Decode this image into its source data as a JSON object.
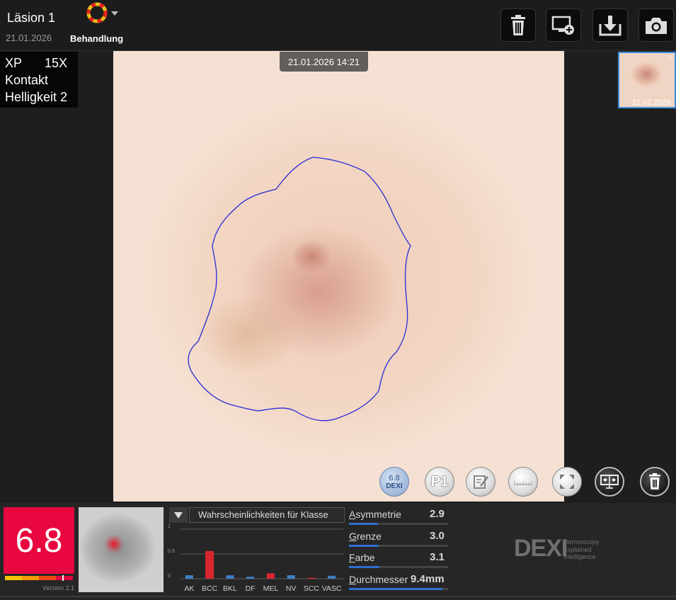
{
  "header": {
    "lesion_title": "Läsion 1",
    "lesion_date": "21.01.2026",
    "treatment_label": "Behandlung",
    "treatment_icon": "treatment-ring-icon",
    "buttons": [
      "trash-icon",
      "add-monitor-icon",
      "download-icon",
      "camera-icon"
    ]
  },
  "image_info": {
    "mode": "XP",
    "zoom": "15X",
    "contact": "Kontakt",
    "brightness": "Helligkeit 2"
  },
  "image": {
    "timestamp": "21.01.2026 14:21"
  },
  "thumbnail": {
    "date": "21.01.2026",
    "close": "×"
  },
  "image_controls": {
    "dexi_score": "6.8",
    "dexi_label": "DEXI",
    "p1_label": "P1",
    "icons": [
      "dexi-score-icon",
      "p1-icon",
      "edit-note-icon",
      "ruler-icon",
      "fullscreen-icon",
      "compare-icon",
      "delete-icon"
    ]
  },
  "score": {
    "value": "6.8",
    "version": "Version 2.1",
    "level": 0.68,
    "color": "#e8073e"
  },
  "probability": {
    "dropdown_label": "Wahrscheinlichkeiten für Klasse"
  },
  "chart_data": {
    "type": "bar",
    "categories": [
      "AK",
      "BCC",
      "BKL",
      "DF",
      "MEL",
      "NV",
      "SCC",
      "VASC"
    ],
    "values": [
      0.07,
      0.56,
      0.07,
      0.04,
      0.11,
      0.07,
      0.02,
      0.06
    ],
    "highlight": [
      "BCC",
      "MEL",
      "SCC"
    ],
    "ylim": [
      0,
      1
    ],
    "yticks": [
      "0",
      "0.5",
      "1"
    ],
    "colors": {
      "default": "#3f7fc6",
      "highlight": "#d8272f"
    }
  },
  "metrics": [
    {
      "first": "A",
      "rest": "symmetrie",
      "value": "2.9",
      "fill": 0.29
    },
    {
      "first": "G",
      "rest": "renze",
      "value": "3.0",
      "fill": 0.3
    },
    {
      "first": "F",
      "rest": "arbe",
      "value": "3.1",
      "fill": 0.31
    },
    {
      "first": "D",
      "rest": "urchmesser",
      "value": "9.4mm",
      "fill": 0.94
    }
  ],
  "logo": {
    "name": "DEXI",
    "line1": "Dermoscopy",
    "line2": "Explained",
    "line3": "Intelligence"
  }
}
